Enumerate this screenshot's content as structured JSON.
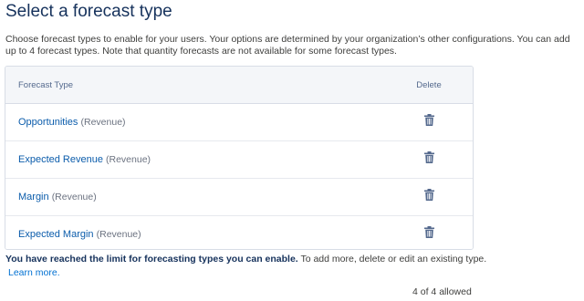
{
  "page": {
    "title": "Select a forecast type",
    "description": "Choose forecast types to enable for your users. Your options are determined by your organization’s other configurations. You can add up to 4 forecast types. Note that quantity forecasts are not available for some forecast types."
  },
  "table": {
    "headers": {
      "type": "Forecast Type",
      "delete": "Delete"
    },
    "rows": [
      {
        "name": "Opportunities",
        "unit": "(Revenue)",
        "delete_icon": "trash-icon"
      },
      {
        "name": "Expected Revenue",
        "unit": "(Revenue)",
        "delete_icon": "trash-icon"
      },
      {
        "name": "Margin",
        "unit": "(Revenue)",
        "delete_icon": "trash-icon"
      },
      {
        "name": "Expected Margin",
        "unit": "(Revenue)",
        "delete_icon": "trash-icon"
      }
    ]
  },
  "footer": {
    "limit_bold": "You have reached the limit for forecasting types you can enable.",
    "limit_rest": " To add more, delete or edit an existing type.",
    "learn_more": "Learn more.",
    "count": "4 of 4 allowed"
  },
  "colors": {
    "link": "#0b5cab",
    "header_bg": "#f4f6f9",
    "border": "#d8dde6",
    "icon": "#54698d"
  }
}
